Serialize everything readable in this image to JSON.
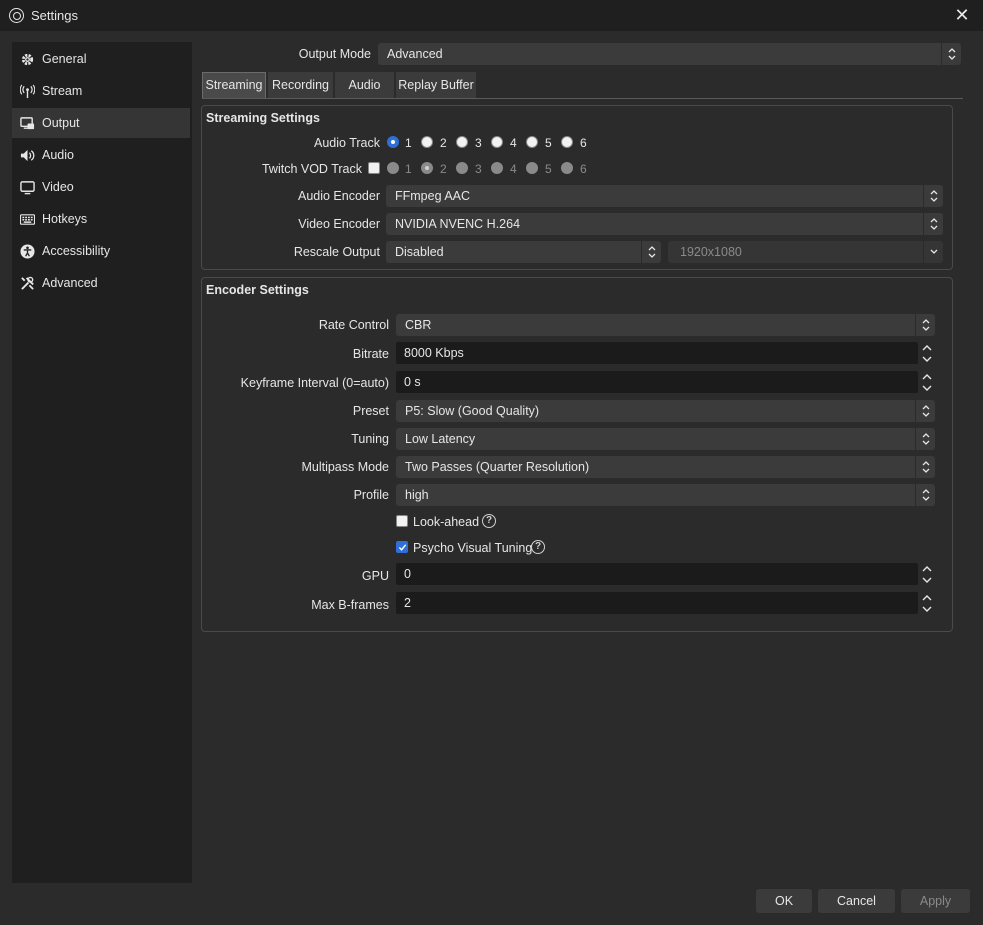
{
  "window": {
    "title": "Settings",
    "close_label": "✕"
  },
  "sidebar": {
    "items": [
      {
        "label": "General",
        "icon": "gear-icon"
      },
      {
        "label": "Stream",
        "icon": "antenna-icon"
      },
      {
        "label": "Output",
        "icon": "output-icon"
      },
      {
        "label": "Audio",
        "icon": "speaker-icon"
      },
      {
        "label": "Video",
        "icon": "monitor-icon"
      },
      {
        "label": "Hotkeys",
        "icon": "keyboard-icon"
      },
      {
        "label": "Accessibility",
        "icon": "accessibility-icon"
      },
      {
        "label": "Advanced",
        "icon": "tools-icon"
      }
    ],
    "active": "Output"
  },
  "output_mode": {
    "label": "Output Mode",
    "value": "Advanced"
  },
  "tabs": [
    {
      "label": "Streaming",
      "active": true
    },
    {
      "label": "Recording"
    },
    {
      "label": "Audio"
    },
    {
      "label": "Replay Buffer"
    }
  ],
  "streaming": {
    "title": "Streaming Settings",
    "audio_track": {
      "label": "Audio Track",
      "options": [
        "1",
        "2",
        "3",
        "4",
        "5",
        "6"
      ],
      "selected": "1"
    },
    "vod_track": {
      "label": "Twitch VOD Track",
      "enabled": false,
      "options": [
        "1",
        "2",
        "3",
        "4",
        "5",
        "6"
      ],
      "selected": "2"
    },
    "audio_encoder": {
      "label": "Audio Encoder",
      "value": "FFmpeg AAC"
    },
    "video_encoder": {
      "label": "Video Encoder",
      "value": "NVIDIA NVENC H.264"
    },
    "rescale": {
      "label": "Rescale Output",
      "value": "Disabled",
      "resolution": "1920x1080"
    }
  },
  "encoder": {
    "title": "Encoder Settings",
    "rate_control": {
      "label": "Rate Control",
      "value": "CBR"
    },
    "bitrate": {
      "label": "Bitrate",
      "value": "8000 Kbps"
    },
    "keyframe": {
      "label": "Keyframe Interval (0=auto)",
      "value": "0 s"
    },
    "preset": {
      "label": "Preset",
      "value": "P5: Slow (Good Quality)"
    },
    "tuning": {
      "label": "Tuning",
      "value": "Low Latency"
    },
    "multipass": {
      "label": "Multipass Mode",
      "value": "Two Passes (Quarter Resolution)"
    },
    "profile": {
      "label": "Profile",
      "value": "high"
    },
    "lookahead": {
      "label": "Look-ahead",
      "checked": false
    },
    "psycho": {
      "label": "Psycho Visual Tuning",
      "checked": true
    },
    "gpu": {
      "label": "GPU",
      "value": "0"
    },
    "bframes": {
      "label": "Max B-frames",
      "value": "2"
    }
  },
  "buttons": {
    "ok": "OK",
    "cancel": "Cancel",
    "apply": "Apply"
  },
  "help_glyph": "?"
}
